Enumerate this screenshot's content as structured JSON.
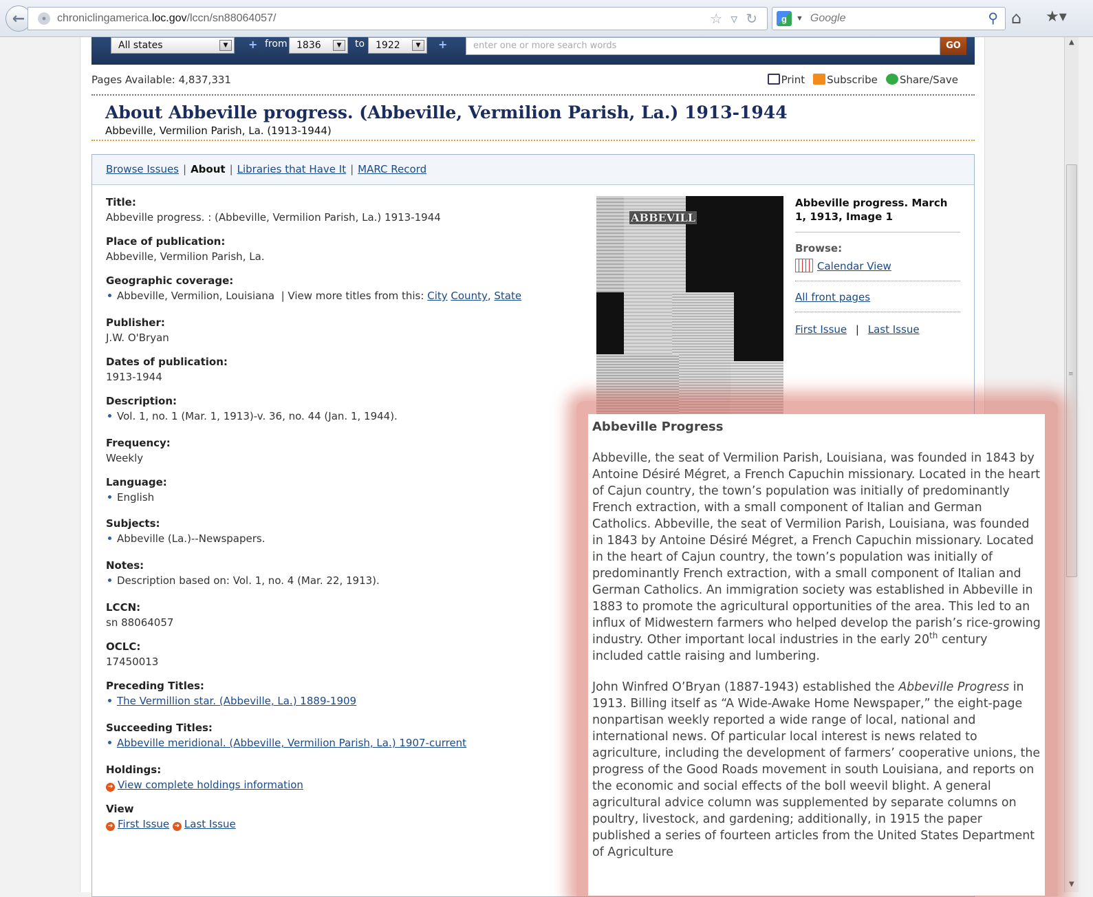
{
  "browser": {
    "url_host": "chroniclingamerica.",
    "url_domain": "loc.gov",
    "url_path": "/lccn/sn88064057/",
    "search_engine_label": "Google"
  },
  "search_strip": {
    "state_select": "All states",
    "from_label": "from",
    "from_year": "1836",
    "to_label": "to",
    "to_year": "1922",
    "keywords_placeholder": "enter one or more search words",
    "go_label": "GO"
  },
  "toolbar": {
    "pages_available": "Pages Available: 4,837,331",
    "print_label": "Print",
    "subscribe_label": "Subscribe",
    "share_label": "Share/Save"
  },
  "title": {
    "main": "About Abbeville progress. (Abbeville, Vermilion Parish, La.) 1913-1944",
    "sub": "Abbeville, Vermilion Parish, La. (1913-1944)"
  },
  "tabs": {
    "browse": "Browse Issues",
    "about": "About",
    "libraries": "Libraries that Have It",
    "marc": "MARC Record"
  },
  "fields": {
    "title_label": "Title:",
    "title_value": "Abbeville progress. : (Abbeville, Vermilion Parish, La.) 1913-1944",
    "place_label": "Place of publication:",
    "place_value": "Abbeville, Vermilion Parish, La.",
    "geo_label": "Geographic coverage:",
    "geo_value": "Abbeville, Vermilion, Louisiana",
    "geo_more": "|  View more titles from this:",
    "geo_city": "City",
    "geo_county": "County",
    "geo_state": "State",
    "publisher_label": "Publisher:",
    "publisher_value": "J.W. O'Bryan",
    "dates_label": "Dates of publication:",
    "dates_value": "1913-1944",
    "description_label": "Description:",
    "description_value": "Vol. 1, no. 1 (Mar. 1, 1913)-v. 36, no. 44 (Jan. 1, 1944).",
    "frequency_label": "Frequency:",
    "frequency_value": "Weekly",
    "language_label": "Language:",
    "language_value": "English",
    "subjects_label": "Subjects:",
    "subjects_value": "Abbeville (La.)--Newspapers.",
    "notes_label": "Notes:",
    "notes_value": "Description based on: Vol. 1, no. 4 (Mar. 22, 1913).",
    "lccn_label": "LCCN:",
    "lccn_value": "sn 88064057",
    "oclc_label": "OCLC:",
    "oclc_value": "17450013",
    "preceding_label": "Preceding Titles:",
    "preceding_value": "The Vermillion star. (Abbeville, La.) 1889-1909",
    "succeeding_label": "Succeeding Titles:",
    "succeeding_value": "Abbeville meridional. (Abbeville, Vermilion Parish, La.) 1907-current",
    "holdings_label": "Holdings:",
    "holdings_value": "View complete holdings information",
    "view_label": "View",
    "view_first": "First Issue",
    "view_last": "Last Issue"
  },
  "thumbnail": {
    "masthead": "ABBEVILL"
  },
  "sidebar": {
    "image_title": "Abbeville progress. March 1, 1913, Image 1",
    "browse_label": "Browse:",
    "calendar_view": "Calendar View",
    "all_front_pages": "All front pages",
    "first_issue": "First Issue",
    "separator": "|",
    "last_issue": "Last Issue"
  },
  "popup": {
    "heading": "Abbeville Progress",
    "p1": "Abbeville, the seat of Vermilion Parish, Louisiana, was founded in 1843 by Antoine Désiré Mégret, a French Capuchin missionary. Located in the heart of Cajun country, the town’s population was initially of predominantly French extraction, with a small component of Italian and German Catholics. Abbeville, the seat of Vermilion Parish, Louisiana, was founded in 1843 by Antoine Désiré Mégret, a French Capuchin missionary. Located in the heart of Cajun country, the town’s population was initially of predominantly French extraction, with a small component of Italian and German Catholics. An immigration society was established in Abbeville in 1883 to promote the agricultural opportunities of the area. This led to an influx of Midwestern farmers who helped develop the parish’s rice-growing industry. Other important local industries in the early 20",
    "p1_sup": "th",
    "p1_end": " century included cattle raising and lumbering.",
    "p2_start": "John Winfred O’Bryan (1887-1943) established the ",
    "p2_italic": "Abbeville Progress",
    "p2_rest": " in 1913. Billing itself as “A Wide-Awake Home Newspaper,” the eight-page nonpartisan weekly reported a wide range of local, national and international news. Of particular local interest is news related to agriculture, including the development of farmers’ cooperative unions, the progress of the Good Roads movement in south Louisiana, and reports on the economic and social effects of the boll weevil blight. A general agricultural advice column was supplemented by separate columns on poultry, livestock, and gardening; additionally, in 1915 the paper published a series of fourteen articles from the United States Department of Agriculture"
  }
}
